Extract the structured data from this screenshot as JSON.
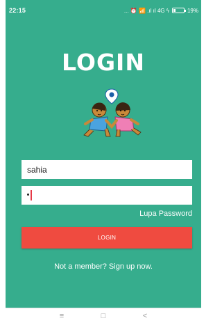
{
  "status_bar": {
    "time": "22:15",
    "icons_text": "... ⏰ 📶 .ıl ıl 4G ϟ",
    "battery_percent": "19%"
  },
  "main": {
    "title": "LOGIN",
    "username": {
      "value": "sahia",
      "placeholder": ""
    },
    "password": {
      "value": "•",
      "placeholder": ""
    },
    "forgot_password": "Lupa Password",
    "login_button": "LOGIN",
    "signup_link": "Not a member? Sign up now."
  },
  "nav_bar": {
    "menu_icon": "≡",
    "home_icon": "□",
    "back_icon": "<"
  },
  "colors": {
    "primary": "#36ad8d",
    "button": "#ef4b40",
    "text_on_primary": "#ffffff"
  }
}
